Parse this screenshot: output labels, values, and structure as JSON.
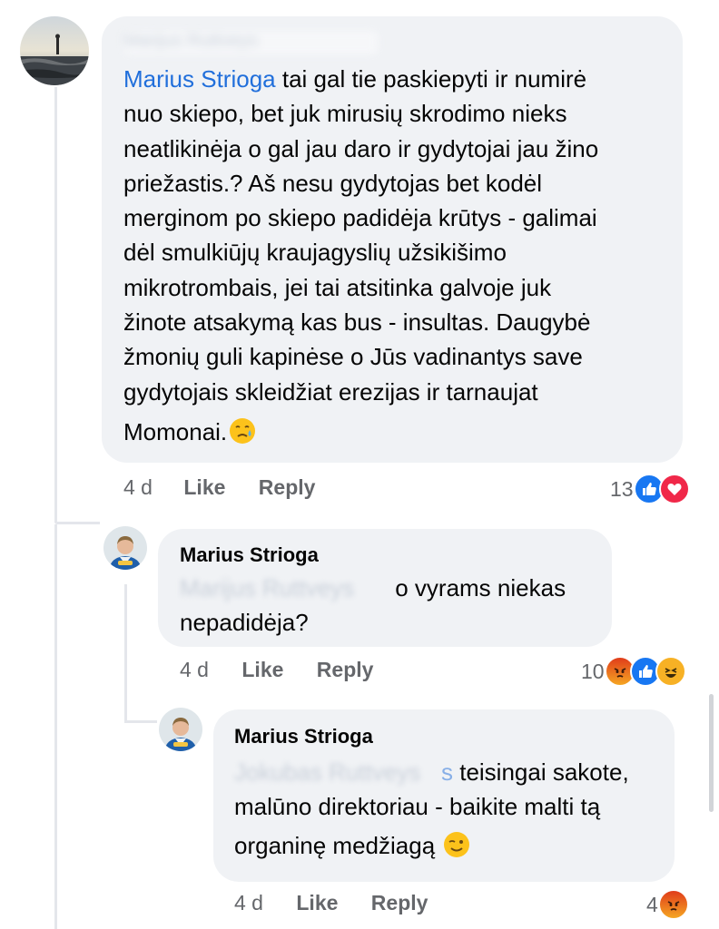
{
  "comments": [
    {
      "author_redacted": "Marijus Ruttveys",
      "mention": "Marius Strioga",
      "lines": [
        " tai gal tie paskiepyti ir numirė",
        "nuo skiepo, bet juk mirusių skrodimo nieks",
        "neatlikinėja o gal jau daro ir gydytojai jau žino",
        "priežastis.? Aš nesu gydytojas bet kodėl",
        "merginom po skiepo padidėja krūtys - galimai",
        "dėl smulkiūjų kraujagyslių užsikišimo",
        "mikrotrombais, jei tai atsitinka galvoje juk",
        "žinote atsakymą kas bus - insultas. Daugybė",
        "žmonių guli kapinėse o Jūs vadinantys save",
        "gydytojais skleidžiat erezijas ir tarnaujat",
        "Momonai."
      ],
      "emoji": "sad-tear-emoji",
      "time": "4 d",
      "like_label": "Like",
      "reply_label": "Reply",
      "reaction_count": "13",
      "reactions": [
        "like-reaction-icon",
        "love-reaction-icon"
      ]
    },
    {
      "author": "Marius Strioga",
      "redacted_prefix": "Marijus Ruttveys",
      "lines": [
        " o vyrams niekas",
        "nepadidėja?"
      ],
      "time": "4 d",
      "like_label": "Like",
      "reply_label": "Reply",
      "reaction_count": "10",
      "reactions": [
        "angry-reaction-icon",
        "like-reaction-icon",
        "haha-reaction-icon"
      ]
    },
    {
      "author": "Marius Strioga",
      "redacted_prefix": "Jokubas Ruttveys",
      "redacted_suffix": "s",
      "lines": [
        " teisingai sakote,",
        "malūno direktoriau - baikite malti tą",
        "organinę medžiagą"
      ],
      "emoji": "wink-emoji",
      "time": "4 d",
      "like_label": "Like",
      "reply_label": "Reply",
      "reaction_count": "4",
      "reactions": [
        "angry-reaction-icon"
      ]
    }
  ],
  "colors": {
    "mention": "#216fdb",
    "bubble": "#f0f2f5",
    "meta": "#65676b",
    "like": "#1877f2",
    "love": "#f02849"
  }
}
